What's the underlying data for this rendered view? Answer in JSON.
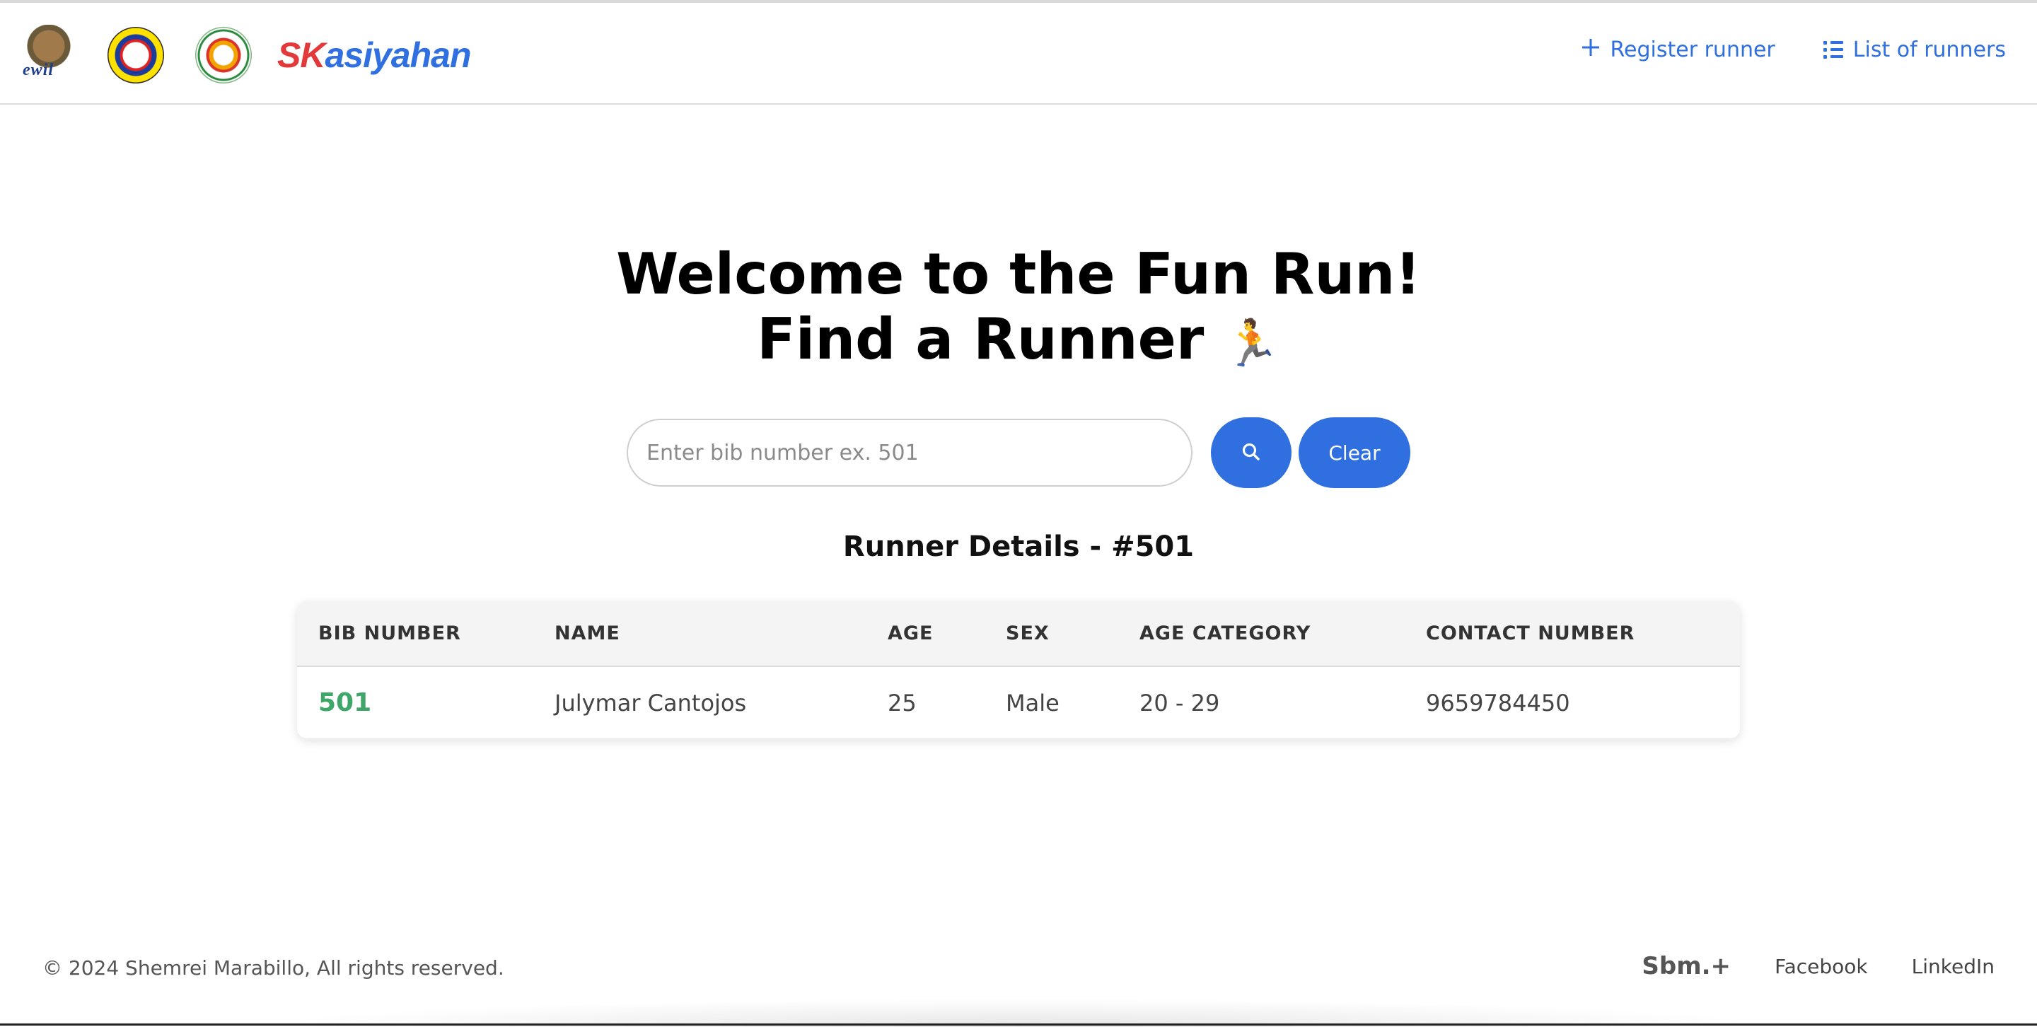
{
  "header": {
    "brand_prefix": "SK",
    "brand_rest": "asiyahan",
    "logos": [
      {
        "name": "ewil-logo",
        "text": "ewil"
      },
      {
        "name": "city-of-san-carlos-seal"
      },
      {
        "name": "san-carlos-sk-seal"
      }
    ],
    "nav": {
      "register_label": "Register runner",
      "list_label": "List of runners"
    }
  },
  "hero": {
    "line1": "Welcome to the Fun Run!",
    "line2": "Find a Runner",
    "emoji": "🏃"
  },
  "search": {
    "placeholder": "Enter bib number ex. 501",
    "value": "",
    "search_icon": "search-icon",
    "clear_label": "Clear"
  },
  "results": {
    "title": "Runner Details - #501",
    "columns": [
      "BIB NUMBER",
      "NAME",
      "AGE",
      "SEX",
      "AGE CATEGORY",
      "CONTACT NUMBER"
    ],
    "rows": [
      {
        "bib": "501",
        "name": "Julymar Cantojos",
        "age": "25",
        "sex": "Male",
        "age_category": "20 - 29",
        "contact": "9659784450"
      }
    ]
  },
  "footer": {
    "copyright": "© 2024 Shemrei Marabillo, All rights reserved.",
    "brand": "Sbm.+",
    "facebook": "Facebook",
    "linkedin": "LinkedIn"
  },
  "colors": {
    "accent": "#2f6fe0",
    "brand_red": "#e23a3a",
    "bib_green": "#3fa66a"
  }
}
